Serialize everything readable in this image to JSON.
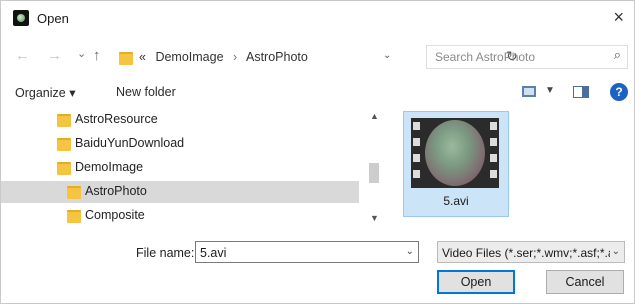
{
  "window": {
    "title": "Open",
    "close_glyph": "×"
  },
  "nav": {
    "back": "←",
    "forward": "→",
    "recent": "⌄",
    "up": "↑",
    "refresh": "↻"
  },
  "address": {
    "prefix": "«",
    "crumbs": [
      "DemoImage",
      "AstroPhoto"
    ],
    "separator": "›",
    "dropdown": "⌄"
  },
  "search": {
    "placeholder": "Search AstroPhoto",
    "icon": "search-icon"
  },
  "toolbar": {
    "organize": "Organize ▾",
    "new_folder": "New folder",
    "view_dd": "▼",
    "help": "?"
  },
  "tree": {
    "items": [
      {
        "label": "AstroResource",
        "selected": false
      },
      {
        "label": "BaiduYunDownload",
        "selected": false
      },
      {
        "label": "DemoImage",
        "selected": false
      },
      {
        "label": "AstroPhoto",
        "selected": true
      },
      {
        "label": "Composite",
        "selected": false
      }
    ],
    "scroll_up": "▲",
    "scroll_down": "▼"
  },
  "files": [
    {
      "name": "5.avi",
      "type": "video",
      "selected": true
    }
  ],
  "footer": {
    "file_name_label": "File name:",
    "file_name_value": "5.avi",
    "file_type": "Video Files (*.ser;*.wmv;*.asf;*.avi)",
    "dropdown": "⌄",
    "open": "Open",
    "cancel": "Cancel"
  },
  "colors": {
    "selection": "#cce4f7",
    "tree_selection": "#d9d9d9",
    "folder": "#f5c542",
    "accent": "#0078d7"
  }
}
